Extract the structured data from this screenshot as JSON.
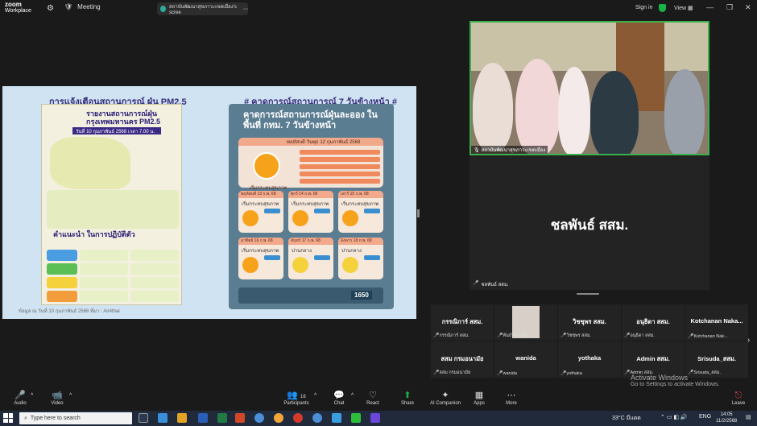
{
  "topbar": {
    "logo_top": "zoom",
    "logo_bottom": "Workplace",
    "meeting_label": "Meeting",
    "share_title": "สถาบันพัฒนาสุขภาวะเขตเมือง's scree",
    "signin": "Sign in",
    "view": "View"
  },
  "slide": {
    "left_title": "การแจ้งเตือนสถานการณ์ ฝุ่น PM2.5",
    "right_title": "# คาดการณ์สถานการณ์ 7 วันข้างหน้า #",
    "poster1_heading": "รายงานสถานการณ์ฝุ่น กรุงเทพมหานคร PM2.5",
    "poster1_date": "วันที่ 10 กุมภาพันธ์ 2568 เวลา 7.00 น.",
    "poster1_advice": "คำแนะนำ ในการปฏิบัติตัว",
    "footer": "ข้อมูล ณ วันที่ 10 กุมภาพันธ์ 2568 ที่มา : Air4thai",
    "poster2_title": "คาดการณ์สถานการณ์ฝุ่นละออง ในพื้นที่ กทม. 7 วันข้างหน้า",
    "poster2_day_head": "พฤหัสบดี วันพุธ 12 กุมภาพันธ์ 2568",
    "poster2_day_label": "เริ่มกระทบสุขภาพ",
    "poster2_count": "1650",
    "cards": [
      {
        "head": "พฤหัสบดี 13 ก.พ. 68",
        "text": "เริ่มกระทบสุขภาพ",
        "face": "orange"
      },
      {
        "head": "ศุกร์ 14 ก.พ. 68",
        "text": "เริ่มกระทบสุขภาพ",
        "face": "orange"
      },
      {
        "head": "เสาร์ 15 ก.พ. 68",
        "text": "เริ่มกระทบสุขภาพ",
        "face": "orange"
      },
      {
        "head": "อาทิตย์ 16 ก.พ. 68",
        "text": "เริ่มกระทบสุขภาพ",
        "face": "orange"
      },
      {
        "head": "จันทร์ 17 ก.พ. 68",
        "text": "ปานกลาง",
        "face": "yellow"
      },
      {
        "head": "อังคาร 18 ก.พ. 68",
        "text": "ปานกลาง",
        "face": "yellow"
      }
    ]
  },
  "video": {
    "name": "สถาบันพัฒนาสุขภาวะเขตเมือง"
  },
  "big_tile": {
    "name": "ชลพันธ์ สสม.",
    "sub": "ชลพันธ์ สสม."
  },
  "gallery": [
    {
      "name": "กรรณิการ์ สสม.",
      "sub": "กรรณิการ์ สสม."
    },
    {
      "name": "",
      "sub": "พันธ์ทิพา สสม."
    },
    {
      "name": "วิชชุพร สสม.",
      "sub": "วิชชุพร สสม."
    },
    {
      "name": "อนุธิดา สสม.",
      "sub": "อนุธิดา สสม."
    },
    {
      "name": "Kotchanan Naka...",
      "sub": "Kotchanan Nak..."
    },
    {
      "name": "สสม กรมอนามัย",
      "sub": "สสม กรมอนามัย"
    },
    {
      "name": "wanida",
      "sub": "wanida"
    },
    {
      "name": "yothaka",
      "sub": "yothaka"
    },
    {
      "name": "Admin สสม.",
      "sub": "Admin สสม."
    },
    {
      "name": "Srisuda_สสม.",
      "sub": "Srisuda_สสม."
    }
  ],
  "activate": {
    "title": "Activate Windows",
    "sub": "Go to Settings to activate Windows."
  },
  "toolbar": {
    "audio": "Audio",
    "video": "Video",
    "participants": "Participants",
    "participants_count": "16",
    "chat": "Chat",
    "react": "React",
    "share": "Share",
    "ai": "AI Companion",
    "apps": "Apps",
    "more": "More",
    "leave": "Leave"
  },
  "taskbar": {
    "search": "Type here to search",
    "weather": "33°C มีแดด",
    "lang": "ENG",
    "time": "14:05",
    "date": "11/2/2568"
  },
  "colors": {
    "accent_green": "#3ab14a",
    "danger": "#e04848",
    "bg": "#1a1a1a"
  }
}
